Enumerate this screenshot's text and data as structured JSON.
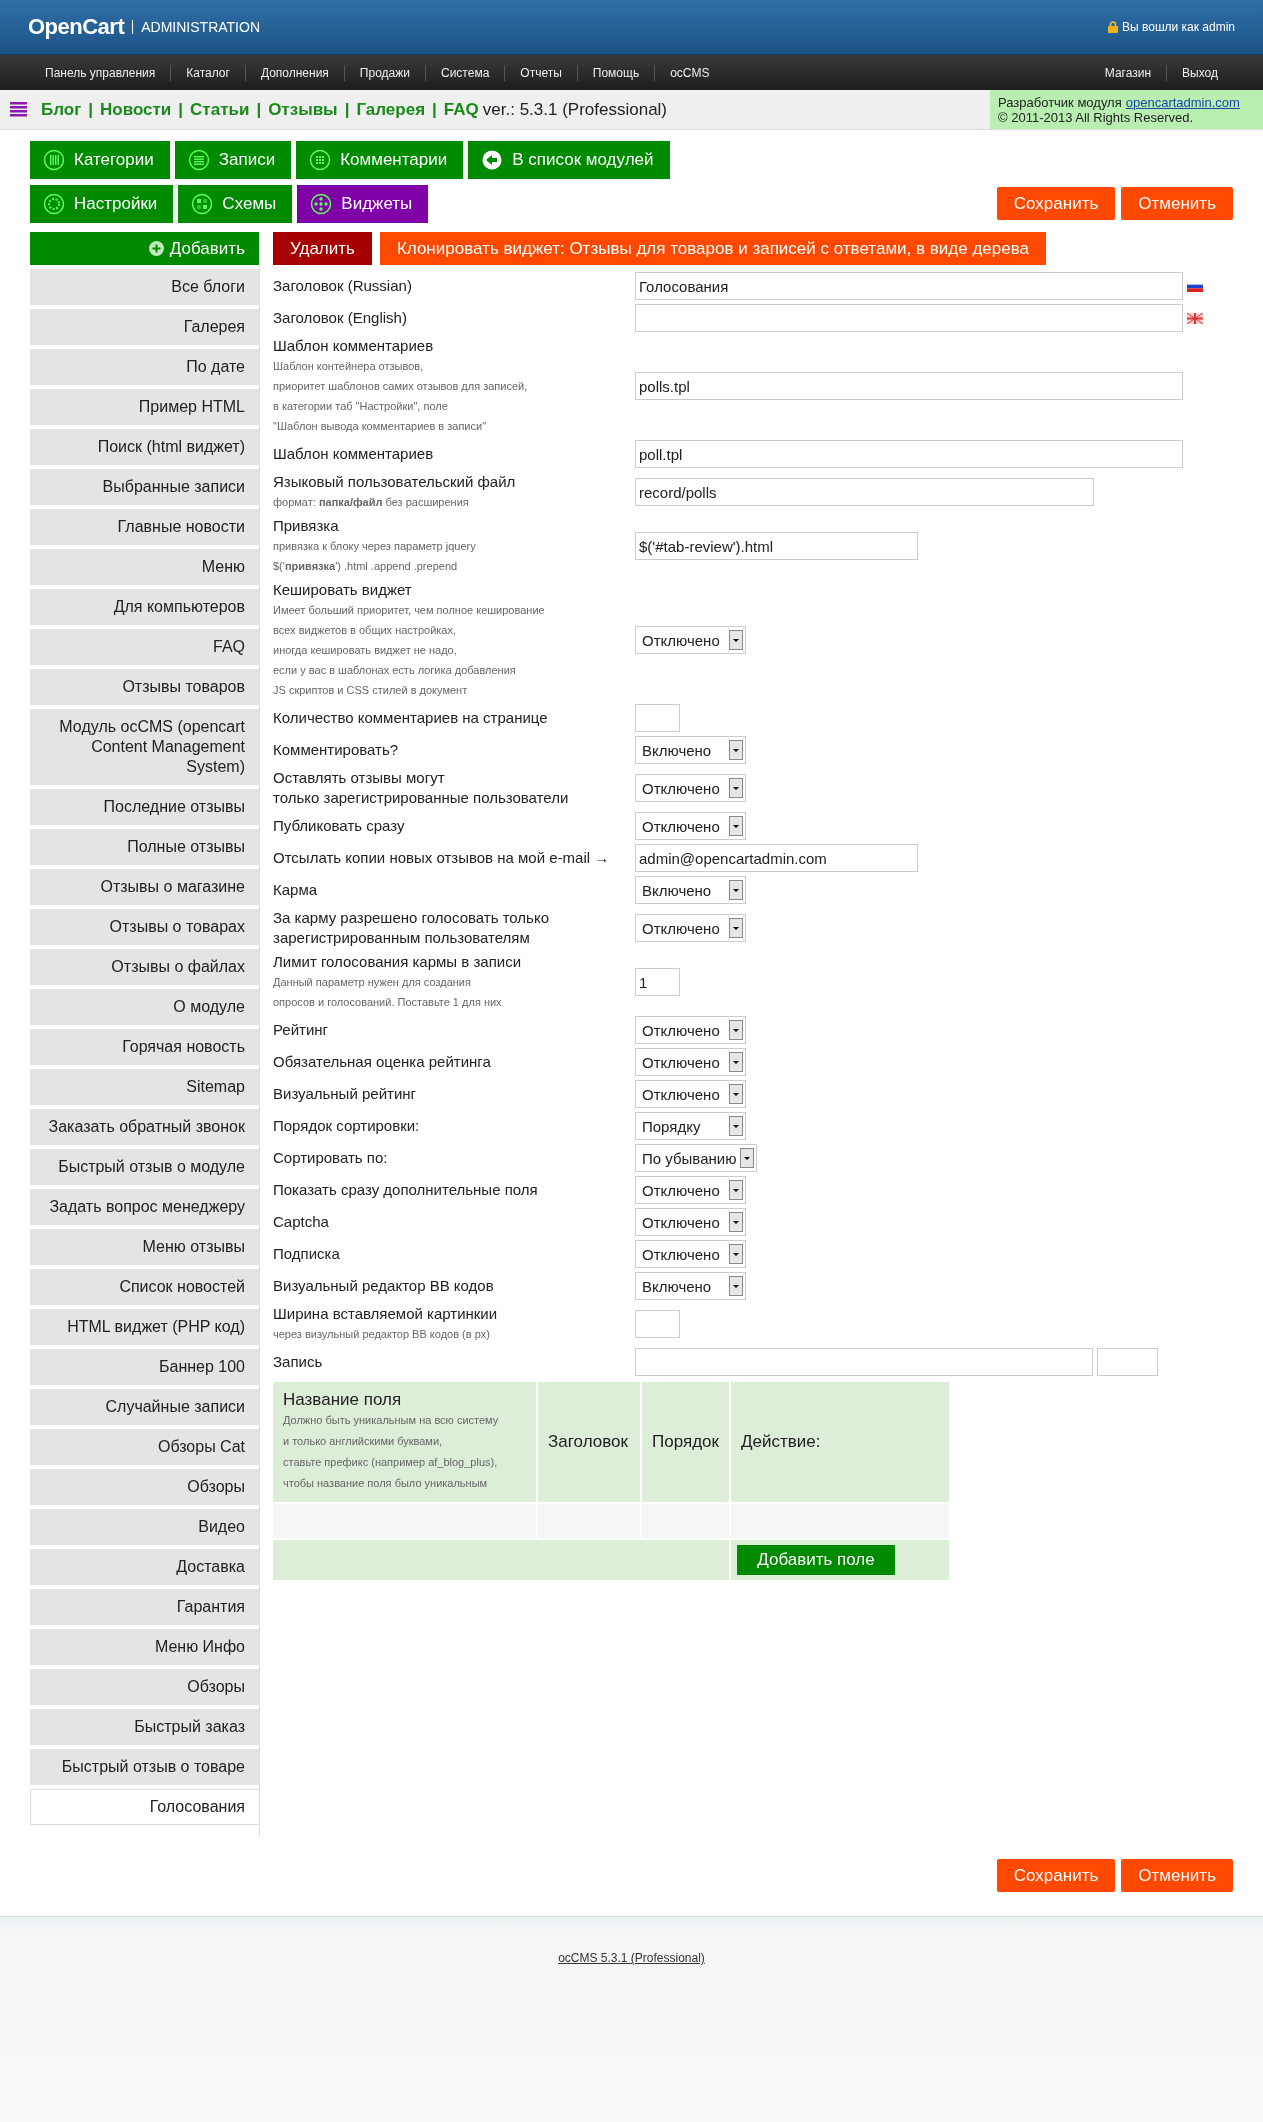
{
  "header": {
    "logo": "OpenCart",
    "subtitle": "ADMINISTRATION",
    "user": "Вы вошли как admin"
  },
  "nav": {
    "left": [
      "Панель управления",
      "Каталог",
      "Дополнения",
      "Продажи",
      "Система",
      "Отчеты",
      "Помощь",
      "ocCMS"
    ],
    "right": [
      "Магазин",
      "Выход"
    ]
  },
  "breadcrumb": {
    "links": [
      "Блог",
      "Новости",
      "Статьи",
      "Отзывы",
      "Галерея",
      "FAQ"
    ],
    "separator": "|",
    "version": "ver.: 5.3.1 (Professional)"
  },
  "developer": {
    "label": "Разработчик модуля",
    "link": "opencartadmin.com",
    "copyright": "© 2011-2013 All Rights Reserved."
  },
  "module_tabs": [
    {
      "label": "Категории",
      "selected": false
    },
    {
      "label": "Записи",
      "selected": false
    },
    {
      "label": "Комментарии",
      "selected": false
    },
    {
      "label": "В список модулей",
      "selected": false
    },
    {
      "label": "Настройки",
      "selected": false
    },
    {
      "label": "Схемы",
      "selected": false
    },
    {
      "label": "Виджеты",
      "selected": true
    }
  ],
  "actions_top": [
    "Сохранить",
    "Отменить"
  ],
  "sidebar": {
    "add_button": "Добавить",
    "items": [
      {
        "label": "Все блоги",
        "selected": false
      },
      {
        "label": "Галерея",
        "selected": false
      },
      {
        "label": "По дате",
        "selected": false
      },
      {
        "label": "Пример HTML",
        "selected": false
      },
      {
        "label": "Поиск (html виджет)",
        "selected": false
      },
      {
        "label": "Выбранные записи",
        "selected": false
      },
      {
        "label": "Главные новости",
        "selected": false
      },
      {
        "label": "Меню",
        "selected": false
      },
      {
        "label": "Для компьютеров",
        "selected": false
      },
      {
        "label": "FAQ",
        "selected": false
      },
      {
        "label": "Отзывы товаров",
        "selected": false
      },
      {
        "label": "Модуль ocCMS (opencart Content Management System)",
        "selected": false
      },
      {
        "label": "Последние отзывы",
        "selected": false
      },
      {
        "label": "Полные отзывы",
        "selected": false
      },
      {
        "label": "Отзывы о магазине",
        "selected": false
      },
      {
        "label": "Отзывы о товарах",
        "selected": false
      },
      {
        "label": "Отзывы о файлах",
        "selected": false
      },
      {
        "label": "О модуле",
        "selected": false
      },
      {
        "label": "Горячая новость",
        "selected": false
      },
      {
        "label": "Sitemap",
        "selected": false
      },
      {
        "label": "Заказать обратный звонок",
        "selected": false
      },
      {
        "label": "Быстрый отзыв о модуле",
        "selected": false
      },
      {
        "label": "Задать вопрос менеджеру",
        "selected": false
      },
      {
        "label": "Меню отзывы",
        "selected": false
      },
      {
        "label": "Список новостей",
        "selected": false
      },
      {
        "label": "HTML виджет (PHP код)",
        "selected": false
      },
      {
        "label": "Баннер 100",
        "selected": false
      },
      {
        "label": "Случайные записи",
        "selected": false
      },
      {
        "label": "Обзоры Cat",
        "selected": false
      },
      {
        "label": "Обзоры",
        "selected": false
      },
      {
        "label": "Видео",
        "selected": false
      },
      {
        "label": "Доставка",
        "selected": false
      },
      {
        "label": "Гарантия",
        "selected": false
      },
      {
        "label": "Меню Инфо",
        "selected": false
      },
      {
        "label": "Обзоры",
        "selected": false
      },
      {
        "label": "Быстрый заказ",
        "selected": false
      },
      {
        "label": "Быстрый отзыв о товаре",
        "selected": false
      },
      {
        "label": "Голосования",
        "selected": true
      }
    ]
  },
  "widget_actions": {
    "delete": "Удалить",
    "clone": "Клонировать виджет: Отзывы для товаров и записей с ответами, в виде дерева"
  },
  "form": {
    "rows": [
      {
        "label": "Заголовок (Russian)",
        "kind": "wide-ru",
        "value": "Голосования"
      },
      {
        "label": "Заголовок (English)",
        "kind": "wide-uk"
      },
      {
        "label": "Шаблон комментариев",
        "hint": "Шаблон контейнера отзывов,\nприоритет шаблонов самих отзывов для записей,\nв категории таб \"Настройки\", поле\n\"Шаблон вывода комментариев в записи\"",
        "kind": "wide",
        "value": "polls.tpl"
      },
      {
        "label": "Шаблон комментариев",
        "kind": "wide",
        "value": "poll.tpl"
      },
      {
        "label": "Языковый пользовательский файл",
        "hint": "формат: **папка/файл** без расширения",
        "kind": "medium",
        "value": "record/polls"
      },
      {
        "label": "Привязка",
        "hint": "привязка к блоку через параметр jquery\n$('**привязка**') .html .append .prepend",
        "kind": "short",
        "value": "$('#tab-review').html"
      },
      {
        "label": "Кешировать виджет",
        "hint": "Имеет больший приоритет, чем полное кеширование\nвсех виджетов в общих настройках,\nиногда кешировать виджет не надо,\nесли у вас в шаблонах есть логика добавления\nJS скриптов и CSS стилей в документ",
        "kind": "select",
        "value": "Отключено"
      },
      {
        "label": "Количество комментариев на странице",
        "kind": "tiny"
      },
      {
        "label": "Комментировать?",
        "kind": "select",
        "value": "Включено"
      },
      {
        "label": "Оставлять отзывы могут\nтолько зарегистрированные пользователи",
        "kind": "select",
        "value": "Отключено"
      },
      {
        "label": "Публиковать сразу",
        "kind": "select",
        "value": "Отключено"
      },
      {
        "label": "Отсылать копии новых отзывов на мой e-mail →",
        "kind": "short",
        "value": "admin@opencartadmin.com"
      },
      {
        "label": "Карма",
        "kind": "select",
        "value": "Включено"
      },
      {
        "label": "За карму разрешено голосовать только\nзарегистрированным пользователям",
        "kind": "select",
        "value": "Отключено"
      },
      {
        "label": "Лимит голосования кармы в записи",
        "hint": "Данный параметр нужен для создания\nопросов и голосований. Поставьте 1 для них",
        "kind": "tiny",
        "value": "1"
      },
      {
        "label": "Рейтинг",
        "kind": "select",
        "value": "Отключено"
      },
      {
        "label": "Обязательная оценка рейтинга",
        "kind": "select",
        "value": "Отключено"
      },
      {
        "label": "Визуальный рейтинг",
        "kind": "select",
        "value": "Отключено"
      },
      {
        "label": "Порядок сортировки:",
        "kind": "select",
        "value": "Порядку"
      },
      {
        "label": "Сортировать по:",
        "kind": "select",
        "value": "По убыванию"
      },
      {
        "label": "Показать сразу дополнительные поля",
        "kind": "select",
        "value": "Отключено"
      },
      {
        "label": "Captcha",
        "kind": "select",
        "value": "Отключено"
      },
      {
        "label": "Подписка",
        "kind": "select",
        "value": "Отключено"
      },
      {
        "label": "Визуальный редактор BB кодов",
        "kind": "select",
        "value": "Включено"
      },
      {
        "label": "Ширина вставляемой картинкии",
        "hint": "через визульный редактор BB кодов (в px)",
        "kind": "tiny"
      },
      {
        "label": "Запись",
        "kind": "pair"
      }
    ]
  },
  "fields_table": {
    "columns": [
      {
        "title": "Название поля",
        "hint": "Должно быть уникальным на всю систему\nи только английскими буквами,\nставьте префикс (например af_blog_plus),\nчтобы название поля было уникальным"
      },
      {
        "title": "Заголовок"
      },
      {
        "title": "Порядок"
      },
      {
        "title": "Действие:"
      }
    ],
    "add_button": "Добавить поле"
  },
  "actions_bottom": [
    "Сохранить",
    "Отменить"
  ],
  "footer": {
    "link": "ocCMS 5.3.1 (Professional)"
  }
}
